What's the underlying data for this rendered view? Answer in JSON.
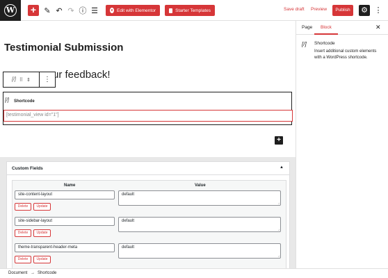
{
  "toolbar": {
    "wp_logo": "W",
    "add_icon": "+",
    "edit_icon": "✎",
    "undo_icon": "↶",
    "redo_icon": "↷",
    "info_icon": "ⓘ",
    "list_icon": "☰",
    "elementor_icon": "e",
    "elementor_label": "Edit with Elementor",
    "starter_label": "Starter Templates",
    "save_draft": "Save draft",
    "preview": "Preview",
    "publish": "Publish",
    "settings_icon": "⚙",
    "more_icon": "⋮"
  },
  "sidebar": {
    "tab_page": "Page",
    "tab_block": "Block",
    "close_icon": "✕",
    "block_icon": "[/]",
    "block_title": "Shortcode",
    "block_description": "Insert additional custom elements with a WordPress shortcode."
  },
  "editor": {
    "post_title": "Testimonial Submission",
    "heading_text": "ur feedback!",
    "block_toolbar": {
      "icon": "[/]",
      "drag_icon": "⠿",
      "move_icon": "⇕",
      "options_icon": "⋮"
    },
    "shortcode": {
      "icon": "[/]",
      "label": "Shortcode",
      "value": "[testimonial_view id=\"1\"]"
    },
    "inserter_icon": "+"
  },
  "custom_fields": {
    "title": "Custom Fields",
    "toggle_icon": "▲",
    "columns": [
      "Name",
      "Value"
    ],
    "delete_label": "Delete",
    "update_label": "Update",
    "resize_icon": "⌟",
    "rows": [
      {
        "name": "site-content-layout",
        "value": "default"
      },
      {
        "name": "site-sidebar-layout",
        "value": "default"
      },
      {
        "name": "theme-transparent-header-meta",
        "value": "default"
      }
    ]
  },
  "footer": {
    "crumb_1": "Document",
    "separator": "→",
    "crumb_2": "Shortcode"
  }
}
